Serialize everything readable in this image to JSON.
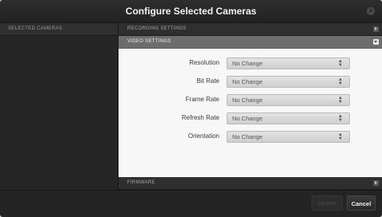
{
  "dialog": {
    "title": "Configure Selected Cameras",
    "close_icon": "close-icon"
  },
  "sidebar": {
    "header": "SELECTED CAMERAS"
  },
  "sections": {
    "recording": {
      "label": "RECORDING SETTINGS",
      "state": "collapsed"
    },
    "video": {
      "label": "VIDEO SETTINGS",
      "state": "expanded"
    },
    "firmware": {
      "label": "FIRMWARE",
      "state": "collapsed"
    }
  },
  "video_settings": {
    "fields": [
      {
        "label": "Resolution",
        "value": "No Change"
      },
      {
        "label": "Bit Rate",
        "value": "No Change"
      },
      {
        "label": "Frame Rate",
        "value": "No Change"
      },
      {
        "label": "Refresh Rate",
        "value": "No Change"
      },
      {
        "label": "Orientation",
        "value": "No Change"
      }
    ]
  },
  "footer": {
    "update_label": "Update",
    "cancel_label": "Cancel"
  },
  "colors": {
    "dialog_bg": "#232323",
    "content_bg": "#f7f7f7",
    "expanded_header": "#6d6d6d"
  }
}
